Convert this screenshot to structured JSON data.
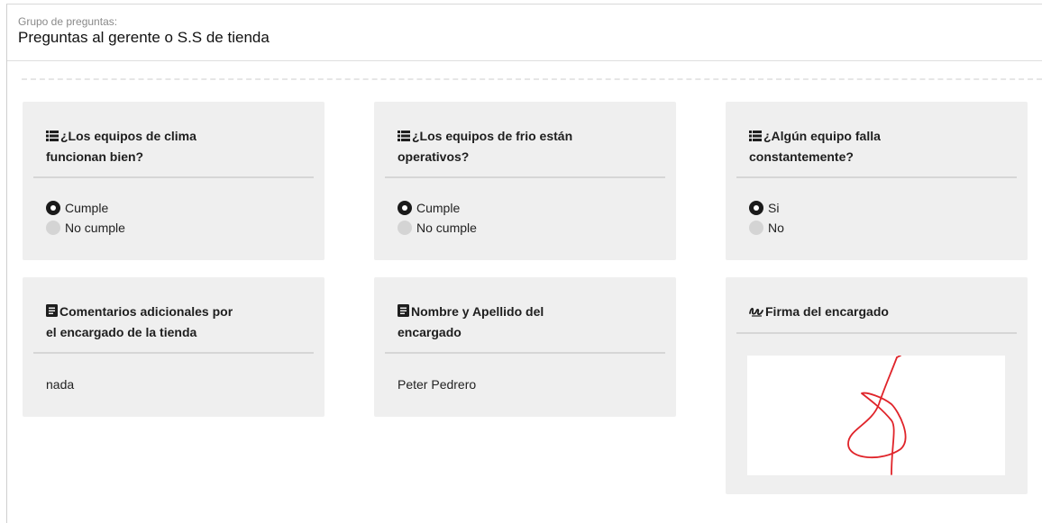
{
  "header": {
    "group_label": "Grupo de preguntas:",
    "group_title": "Preguntas al gerente o S.S de tienda"
  },
  "questions": [
    {
      "title": "¿Los equipos de clima funcionan bien?",
      "icon": "list-icon",
      "options": [
        {
          "label": "Cumple",
          "selected": true
        },
        {
          "label": "No cumple",
          "selected": false
        }
      ]
    },
    {
      "title": "¿Los equipos de frio están operativos?",
      "icon": "list-icon",
      "options": [
        {
          "label": "Cumple",
          "selected": true
        },
        {
          "label": "No cumple",
          "selected": false
        }
      ]
    },
    {
      "title": "¿Algún equipo falla constantemente?",
      "icon": "list-icon",
      "options": [
        {
          "label": "Si",
          "selected": true
        },
        {
          "label": "No",
          "selected": false
        }
      ]
    }
  ],
  "text_answers": [
    {
      "title": "Comentarios adicionales por el encargado de la tienda",
      "icon": "document-icon",
      "value": "nada"
    },
    {
      "title": "Nombre y Apellido del encargado",
      "icon": "document-icon",
      "value": "Peter Pedrero"
    }
  ],
  "signature": {
    "title": "Firma del encargado",
    "icon": "signature-icon",
    "stroke_color": "#e0242a"
  },
  "colors": {
    "card_background": "#efefef",
    "selected_radio": "#1a1a1a",
    "unselected_radio": "#d4d4d4"
  }
}
